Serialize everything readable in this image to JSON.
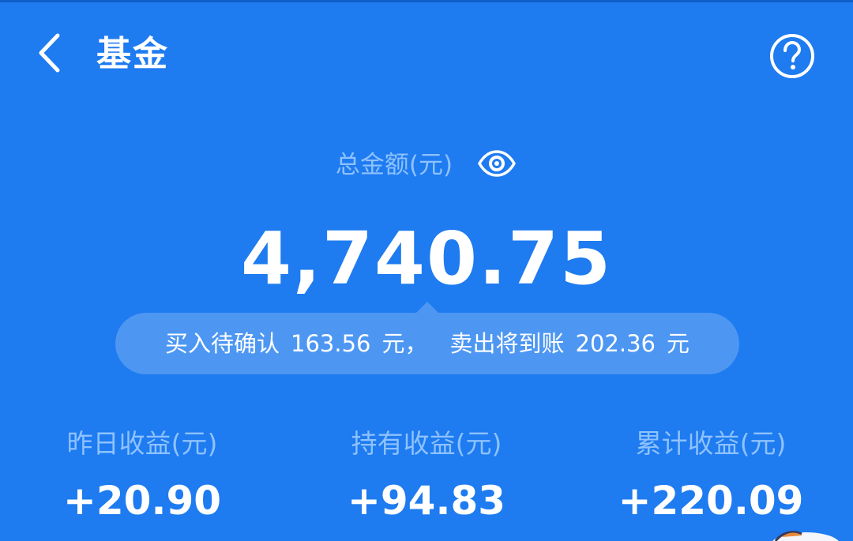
{
  "header": {
    "title": "基金"
  },
  "summary": {
    "total_label": "总金额(元)",
    "total_amount": "4,740.75"
  },
  "pending": {
    "buy_label": "买入待确认",
    "buy_amount": "163.56",
    "buy_unit": "元，",
    "sell_label": "卖出将到账",
    "sell_amount": "202.36",
    "sell_unit": "元"
  },
  "stats": [
    {
      "label": "昨日收益(元)",
      "value": "+20.90"
    },
    {
      "label": "持有收益(元)",
      "value": "+94.83"
    },
    {
      "label": "累计收益(元)",
      "value": "+220.09"
    }
  ],
  "icons": {
    "back": "chevron-left-icon",
    "help": "question-circle-icon",
    "visibility": "eye-icon"
  },
  "colors": {
    "background": "#1e7bf0",
    "label": "#8ec2ff",
    "pill": "#4d97f3",
    "text": "#ffffff"
  }
}
